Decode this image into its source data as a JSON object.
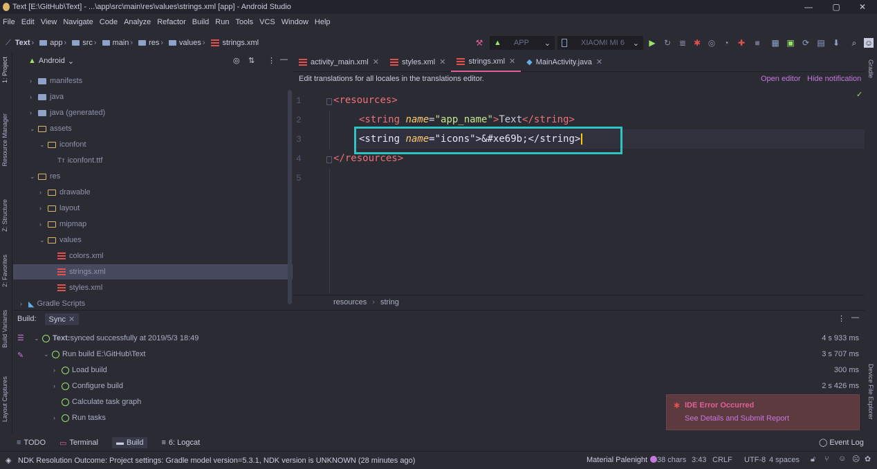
{
  "window": {
    "title": "Text [E:\\GitHub\\Text] - ...\\app\\src\\main\\res\\values\\strings.xml [app] - Android Studio"
  },
  "menu": [
    "File",
    "Edit",
    "View",
    "Navigate",
    "Code",
    "Analyze",
    "Refactor",
    "Build",
    "Run",
    "Tools",
    "VCS",
    "Window",
    "Help"
  ],
  "breadcrumb": [
    "Text",
    "app",
    "src",
    "main",
    "res",
    "values",
    "strings.xml"
  ],
  "toolbar": {
    "config": "APP",
    "device": "XIAOMI MI 6"
  },
  "project": {
    "view": "Android",
    "items": [
      {
        "label": "manifests",
        "indent": 1,
        "arrow": "›",
        "icon": "folder"
      },
      {
        "label": "java",
        "indent": 1,
        "arrow": "›",
        "icon": "folder"
      },
      {
        "label": "java (generated)",
        "indent": 1,
        "arrow": "›",
        "icon": "folder"
      },
      {
        "label": "assets",
        "indent": 1,
        "arrow": "⌄",
        "icon": "folder-open"
      },
      {
        "label": "iconfont",
        "indent": 2,
        "arrow": "⌄",
        "icon": "folder-open"
      },
      {
        "label": "iconfont.ttf",
        "indent": 3,
        "arrow": "",
        "icon": "font"
      },
      {
        "label": "res",
        "indent": 1,
        "arrow": "⌄",
        "icon": "folder-open"
      },
      {
        "label": "drawable",
        "indent": 2,
        "arrow": "›",
        "icon": "folder-open"
      },
      {
        "label": "layout",
        "indent": 2,
        "arrow": "›",
        "icon": "folder-open"
      },
      {
        "label": "mipmap",
        "indent": 2,
        "arrow": "›",
        "icon": "folder-open"
      },
      {
        "label": "values",
        "indent": 2,
        "arrow": "⌄",
        "icon": "folder-open"
      },
      {
        "label": "colors.xml",
        "indent": 3,
        "arrow": "",
        "icon": "xml"
      },
      {
        "label": "strings.xml",
        "indent": 3,
        "arrow": "",
        "icon": "xml",
        "selected": true
      },
      {
        "label": "styles.xml",
        "indent": 3,
        "arrow": "",
        "icon": "xml"
      },
      {
        "label": "Gradle Scripts",
        "indent": 0,
        "arrow": "›",
        "icon": "gradle"
      }
    ]
  },
  "tabs": [
    {
      "label": "activity_main.xml"
    },
    {
      "label": "styles.xml"
    },
    {
      "label": "strings.xml",
      "active": true
    },
    {
      "label": "MainActivity.java"
    }
  ],
  "notification": {
    "text": "Edit translations for all locales in the translations editor.",
    "open": "Open editor",
    "hide": "Hide notification"
  },
  "code": {
    "lines": [
      "1",
      "2",
      "3",
      "4",
      "5"
    ],
    "l1_open": "<",
    "l1_tag": "resources",
    "l1_close": ">",
    "l2_open": "<string ",
    "l2_attr": "name",
    "l2_eq": "=",
    "l2_val": "\"app_name\"",
    "l2_gt": ">",
    "l2_text": "Text",
    "l2_end": "</string>",
    "l3_open": "<string ",
    "l3_attr": "name",
    "l3_eq": "=",
    "l3_val": "\"icons\"",
    "l3_gt": ">",
    "l3_text": "&#xe69b;",
    "l3_end": "</string>",
    "l4_open": "</",
    "l4_tag": "resources",
    "l4_close": ">"
  },
  "editor_breadcrumb": [
    "resources",
    "string"
  ],
  "build": {
    "label": "Build:",
    "tab": "Sync",
    "rows": [
      {
        "bold": "Text:",
        "label": " synced successfully at 2019/5/3 18:49",
        "time": "4 s 933 ms",
        "indent": 0
      },
      {
        "label": "Run build E:\\GitHub\\Text",
        "time": "3 s 707 ms",
        "indent": 1
      },
      {
        "label": "Load build",
        "time": "300 ms",
        "indent": 2
      },
      {
        "label": "Configure build",
        "time": "2 s 426 ms",
        "indent": 2
      },
      {
        "label": "Calculate task graph",
        "time": "",
        "indent": 2
      },
      {
        "label": "Run tasks",
        "time": "",
        "indent": 2
      }
    ]
  },
  "error": {
    "title": "IDE Error Occurred",
    "link": "See Details and Submit Report"
  },
  "bottom_tabs": [
    "TODO",
    "Terminal",
    "Build",
    "6: Logcat"
  ],
  "event_log": "Event Log",
  "status": {
    "message": "NDK Resolution Outcome: Project settings: Gradle model version=5.3.1, NDK version is UNKNOWN (28 minutes ago)",
    "theme": "Material Palenight",
    "chars": "38 chars",
    "pos": "3:43",
    "eol": "CRLF",
    "enc": "UTF-8",
    "indent": "4 spaces"
  },
  "side": {
    "project": "1: Project",
    "resource": "Resource Manager",
    "structure": "Z: Structure",
    "favorites": "2: Favorites",
    "variants": "Build Variants",
    "captures": "Layout Captures",
    "gradle": "Gradle",
    "device": "Device File Explorer"
  },
  "colors": {
    "accent": "#e0609a",
    "bg": "#2b2b33",
    "highlight": "#2ec4c4"
  }
}
